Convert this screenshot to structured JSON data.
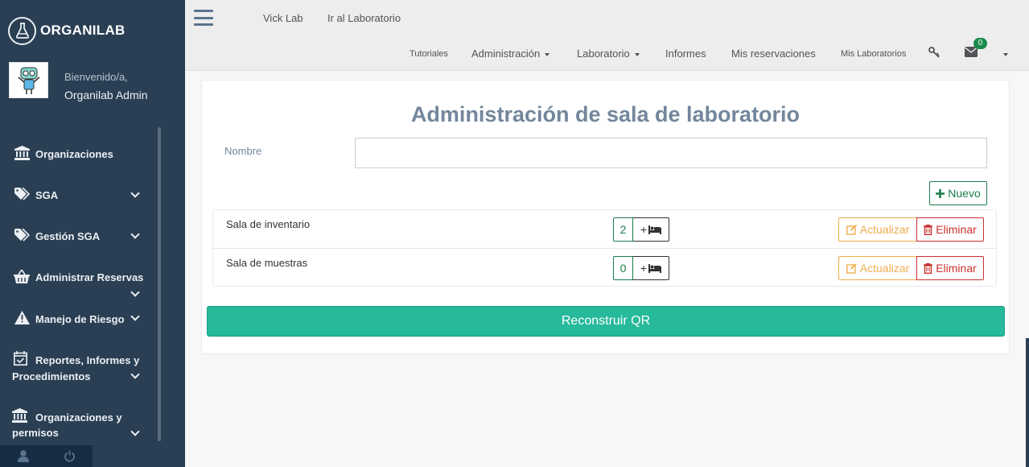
{
  "brand": {
    "name": "ORGANILAB"
  },
  "profile": {
    "welcome": "Bienvenido/a,",
    "name": "Organilab Admin"
  },
  "sidebar": {
    "items": [
      {
        "label": "Organizaciones",
        "icon": "bank-icon",
        "chevron": false
      },
      {
        "label": "SGA",
        "icon": "tags-icon",
        "chevron": true
      },
      {
        "label": "Gestión SGA",
        "icon": "tags-icon",
        "chevron": true
      },
      {
        "label": "Administrar Reservas",
        "icon": "basket-icon",
        "chevron": true
      },
      {
        "label": "Manejo de Riesgo",
        "icon": "warning-icon",
        "chevron": true
      },
      {
        "label_line1": "Reportes, Informes y",
        "label_line2": "Procedimientos",
        "icon": "calendar-check-icon",
        "chevron": true
      },
      {
        "label_line1": "Organizaciones y",
        "label_line2": "permisos",
        "icon": "bank-icon",
        "chevron": true
      }
    ]
  },
  "topnav": {
    "lab_name": "Vick Lab",
    "go_to_lab": "Ir al Laboratorio",
    "links": {
      "tutorials": "Tutoriales",
      "administration": "Administración",
      "laboratory": "Laboratorio",
      "reports": "Informes",
      "my_reservations": "Mis reservaciones",
      "my_labs": "Mis Laboratorios"
    },
    "messages_count": "0"
  },
  "main": {
    "title": "Administración de sala de laboratorio",
    "name_label": "Nombre",
    "name_value": "",
    "new_button": "Nuevo",
    "rooms": [
      {
        "name": "Sala de inventario",
        "count": "2",
        "add_label": "+",
        "update_label": "Actualizar",
        "delete_label": "Eliminar"
      },
      {
        "name": "Sala de muestras",
        "count": "0",
        "add_label": "+",
        "update_label": "Actualizar",
        "delete_label": "Eliminar"
      }
    ],
    "rebuild_qr": "Reconstruir QR"
  },
  "colors": {
    "sidebar_bg": "#2a3f54",
    "primary_green": "#26b99a",
    "warning": "#f0ad4e",
    "danger": "#c9302c",
    "title": "#73879c"
  }
}
